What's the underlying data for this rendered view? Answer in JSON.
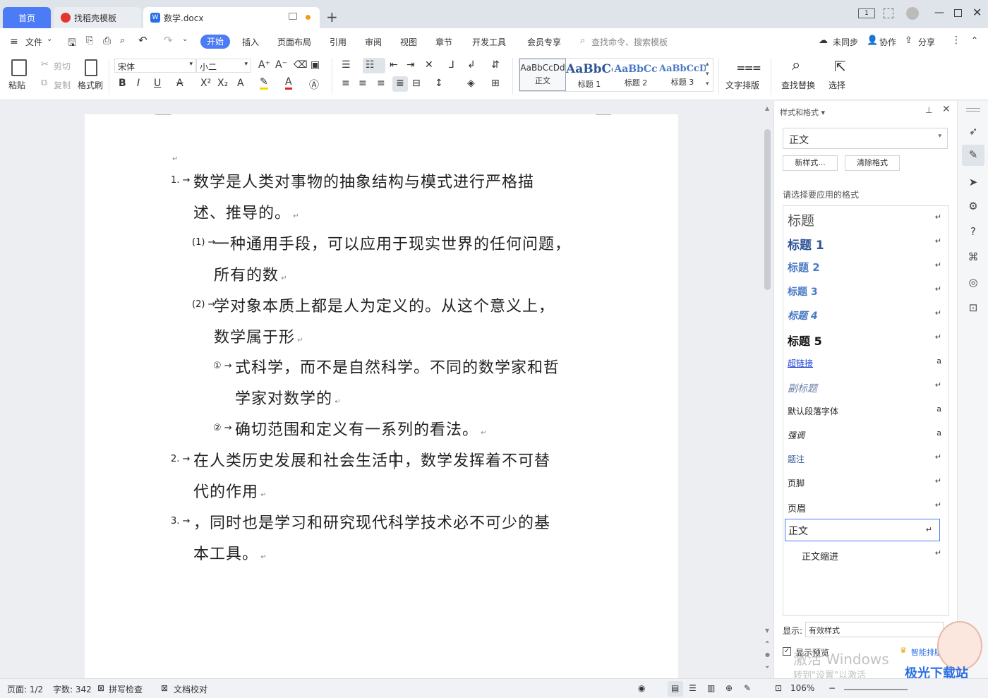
{
  "tabs": {
    "home": "首页",
    "template": "找稻壳模板",
    "doc": "数学.docx"
  },
  "menu": {
    "file": "文件",
    "items": [
      "开始",
      "插入",
      "页面布局",
      "引用",
      "审阅",
      "视图",
      "章节",
      "开发工具",
      "会员专享"
    ],
    "active": "开始",
    "search_placeholder": "查找命令、搜索模板",
    "sync": "未同步",
    "collab": "协作",
    "share": "分享"
  },
  "ribbon": {
    "paste": "粘贴",
    "cut": "剪切",
    "copy": "复制",
    "format_painter": "格式刷",
    "font_name": "宋体",
    "font_size": "小二",
    "text_layout": "文字排版",
    "find_replace": "查找替换",
    "select": "选择",
    "styles": [
      {
        "preview": "AaBbCcDd",
        "name": "正文"
      },
      {
        "preview": "AaBbCc",
        "name": "标题 1"
      },
      {
        "preview": "AaBbCc",
        "name": "标题 2"
      },
      {
        "preview": "AaBbCcD",
        "name": "标题 3"
      }
    ]
  },
  "document": {
    "lines": [
      {
        "num": "1.",
        "text": "数学是人类对事物的抽象结构与模式进行严格描"
      },
      {
        "num": "",
        "text": "述、推导的。"
      },
      {
        "num": "(1)",
        "text": "一种通用手段，可以应用于现实世界的任何问题，"
      },
      {
        "num": "",
        "text": "所有的数"
      },
      {
        "num": "(2)",
        "text": "学对象本质上都是人为定义的。从这个意义上，"
      },
      {
        "num": "",
        "text": "数学属于形"
      },
      {
        "num": "①",
        "text": "式科学，而不是自然科学。不同的数学家和哲"
      },
      {
        "num": "",
        "text": "学家对数学的"
      },
      {
        "num": "②",
        "text": "确切范围和定义有一系列的看法。"
      },
      {
        "num": "2.",
        "text": "在人类历史发展和社会生活中，数学发挥着不可替"
      },
      {
        "num": "",
        "text": "代的作用"
      },
      {
        "num": "3.",
        "text": "，同时也是学习和研究现代科学技术必不可少的基"
      },
      {
        "num": "",
        "text": "本工具。"
      }
    ]
  },
  "panel": {
    "title": "样式和格式",
    "current_style": "正文",
    "new_style": "新样式...",
    "clear_format": "清除格式",
    "prompt": "请选择要应用的格式",
    "styles": [
      "标题",
      "标题 1",
      "标题 2",
      "标题 3",
      "标题 4",
      "标题 5",
      "超链接",
      "副标题",
      "默认段落字体",
      "强调",
      "题注",
      "页脚",
      "页眉",
      "正文",
      "正文缩进"
    ],
    "selected": "正文",
    "show_label": "显示:",
    "show_value": "有效样式",
    "preview_label": "显示预览",
    "smart": "智能排版"
  },
  "watermark": {
    "line1": "激活 Windows",
    "line2": "转到\"设置\"以激活",
    "brand": "极光下载站"
  },
  "status": {
    "page": "页面: 1/2",
    "words": "字数: 342",
    "spell": "拼写检查",
    "proof": "文档校对",
    "zoom": "106%"
  },
  "colors": {
    "accent": "#4b7bf5",
    "tab_bar": "#dfe3ea",
    "heading_blue": "#2f5597"
  }
}
